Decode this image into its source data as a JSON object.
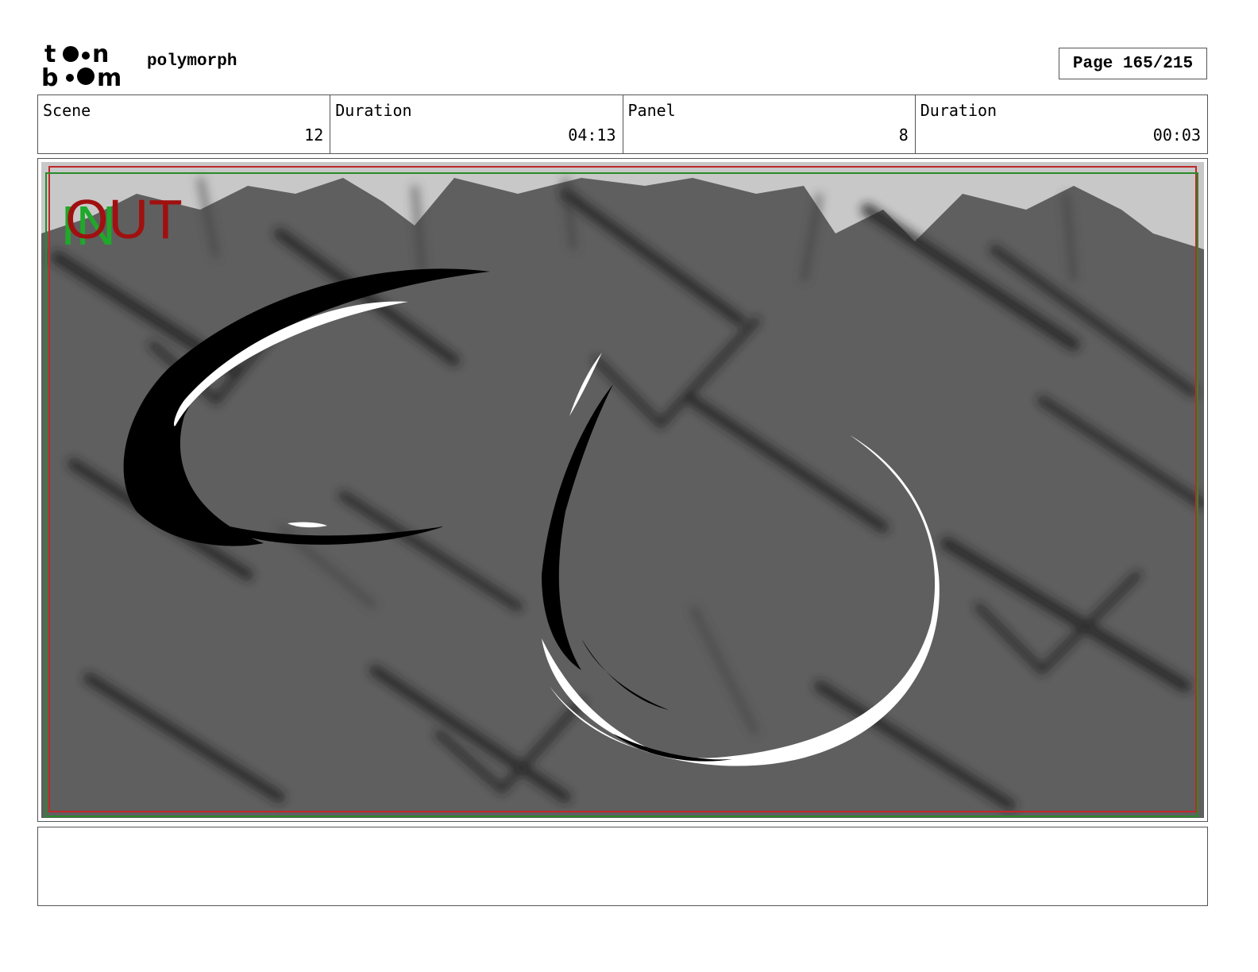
{
  "header": {
    "logo_alt": "toon boom",
    "project_title": "polymorph",
    "page_label": "Page 165/215"
  },
  "info": {
    "scene_label": "Scene",
    "scene_value": "12",
    "scene_duration_label": "Duration",
    "scene_duration_value": "04:13",
    "panel_label": "Panel",
    "panel_value": "8",
    "panel_duration_label": "Duration",
    "panel_duration_value": "00:03"
  },
  "panel": {
    "in_label": "IN",
    "out_label": "OUT",
    "colors": {
      "background": "#5f5f5f",
      "sky": "#c8c8c8",
      "in_green": "#1fa82a",
      "out_red": "#a01010",
      "safe_red": "#c0282a",
      "safe_green": "#2a8a2a"
    }
  },
  "caption": {
    "text": ""
  }
}
